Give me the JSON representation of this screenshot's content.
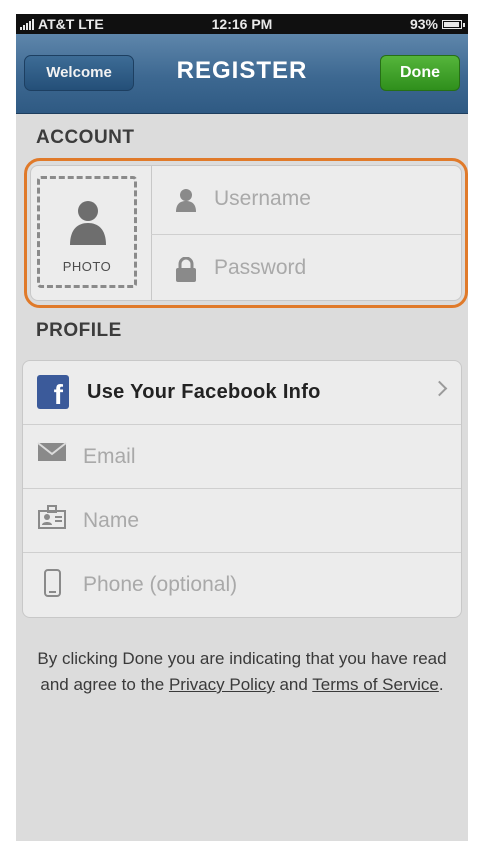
{
  "status_bar": {
    "carrier": "AT&T",
    "network": "LTE",
    "time": "12:16 PM",
    "battery": "93%"
  },
  "nav": {
    "back_label": "Welcome",
    "title": "REGISTER",
    "done_label": "Done",
    "colors": {
      "bar": "#3d6891",
      "done": "#3f9f26"
    }
  },
  "account": {
    "header": "ACCOUNT",
    "photo_label": "PHOTO",
    "username_placeholder": "Username",
    "password_placeholder": "Password",
    "highlight_color": "#e07a2a"
  },
  "profile": {
    "header": "PROFILE",
    "facebook_label": "Use Your Facebook Info",
    "facebook_glyph": "f",
    "email_placeholder": "Email",
    "name_placeholder": "Name",
    "phone_placeholder": "Phone (optional)"
  },
  "terms": {
    "prefix": "By clicking Done you are indicating that you have read and agree to the ",
    "privacy_link": "Privacy Policy",
    "middle": " and ",
    "tos_link": "Terms of Service",
    "suffix": "."
  }
}
